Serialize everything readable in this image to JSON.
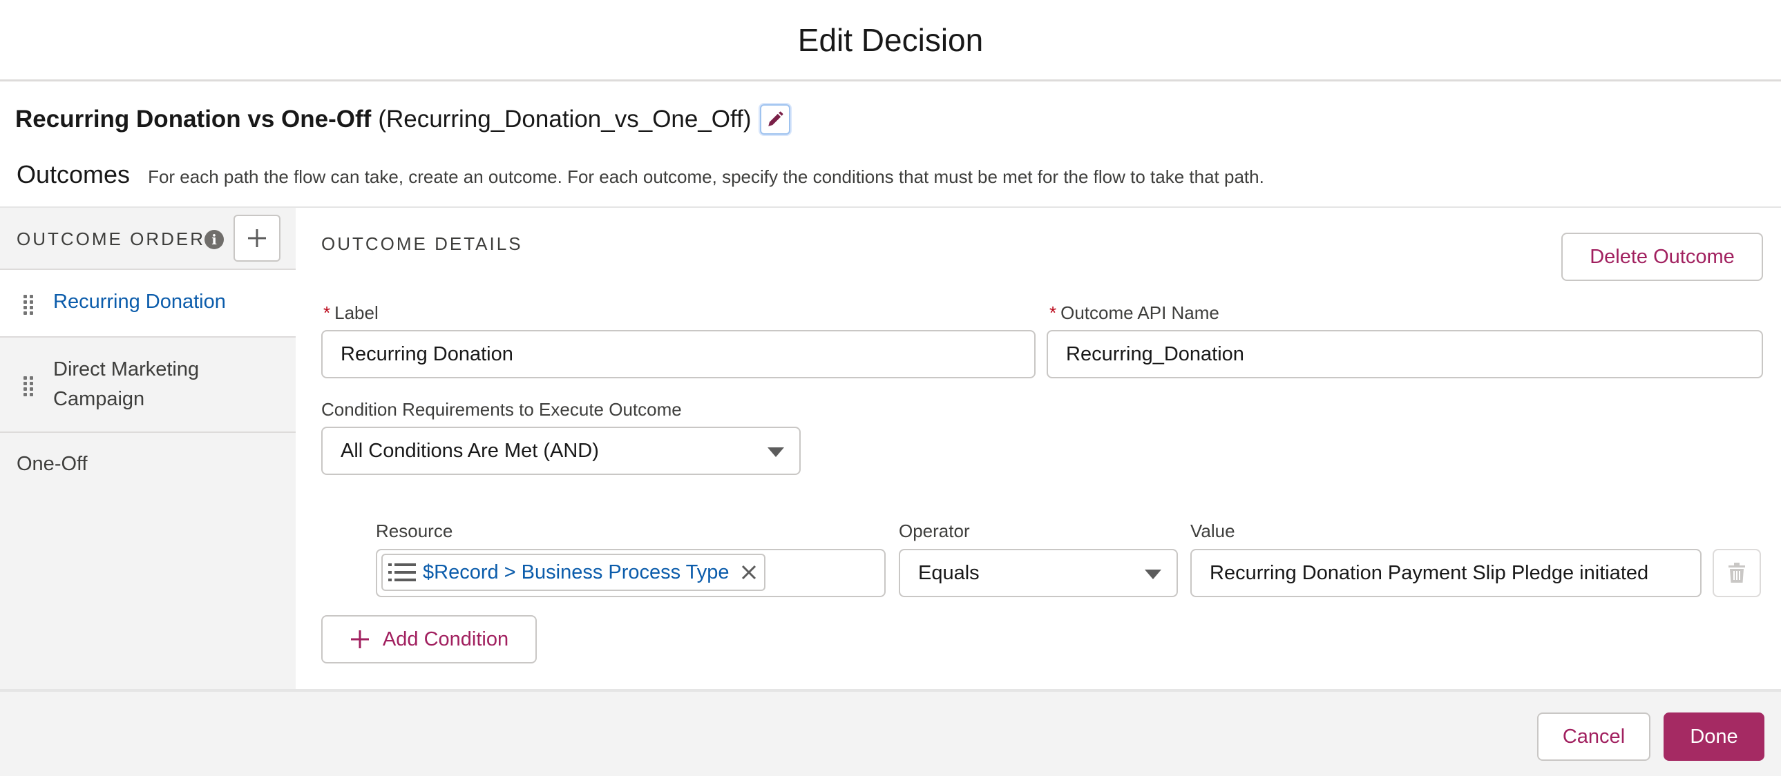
{
  "modal": {
    "title": "Edit Decision"
  },
  "element": {
    "label": "Recurring Donation vs One-Off",
    "api_name": "(Recurring_Donation_vs_One_Off)"
  },
  "outcomes": {
    "title": "Outcomes",
    "description": "For each path the flow can take, create an outcome. For each outcome, specify the conditions that must be met for the flow to take that path."
  },
  "sidebar": {
    "header": "OUTCOME ORDER",
    "info_icon": "info-icon",
    "add_icon": "plus-icon",
    "items": [
      {
        "label": "Recurring Donation",
        "active": true
      },
      {
        "label": "Direct Marketing",
        "label_line2": "Campaign",
        "active": false
      },
      {
        "label": "One-Off",
        "active": false
      }
    ]
  },
  "details": {
    "title": "OUTCOME DETAILS",
    "delete_label": "Delete Outcome",
    "label_field": {
      "required_mark": "*",
      "label": "Label",
      "value": "Recurring Donation"
    },
    "api_field": {
      "required_mark": "*",
      "label": "Outcome API Name",
      "value": "Recurring_Donation"
    },
    "condition_requirements": {
      "label": "Condition Requirements to Execute Outcome",
      "value": "All Conditions Are Met (AND)"
    },
    "condition": {
      "resource_label": "Resource",
      "resource_value": "$Record > Business Process Type",
      "operator_label": "Operator",
      "operator_value": "Equals",
      "value_label": "Value",
      "value_value": "Recurring Donation Payment Slip Pledge initiated"
    },
    "add_condition_label": "Add Condition"
  },
  "footer": {
    "cancel_label": "Cancel",
    "done_label": "Done"
  },
  "colors": {
    "accent": "#a52a63",
    "link": "#0b5cab",
    "required": "#ba0517"
  }
}
